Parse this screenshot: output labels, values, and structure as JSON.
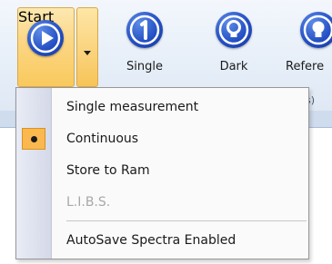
{
  "ribbon": {
    "buttons": [
      {
        "label": "Start",
        "icon": "play-icon"
      },
      {
        "label": "Single",
        "icon": "number-one-icon"
      },
      {
        "label": "Dark",
        "icon": "lightbulb-icon"
      },
      {
        "label": "Refere",
        "icon": "lightbulb-icon"
      }
    ],
    "group_label_fragment": "s)"
  },
  "menu": {
    "items": [
      {
        "label": "Single measurement",
        "checked": false,
        "disabled": false
      },
      {
        "label": "Continuous",
        "checked": true,
        "disabled": false
      },
      {
        "label": "Store to Ram",
        "checked": false,
        "disabled": false
      },
      {
        "label": "L.I.B.S.",
        "checked": false,
        "disabled": true
      },
      {
        "label": "AutoSave Spectra Enabled",
        "checked": false,
        "disabled": false
      }
    ]
  },
  "colors": {
    "accent_pressed": "#f9c95d",
    "icon_blue": "#2450c4",
    "check_highlight": "#fbb84f"
  }
}
